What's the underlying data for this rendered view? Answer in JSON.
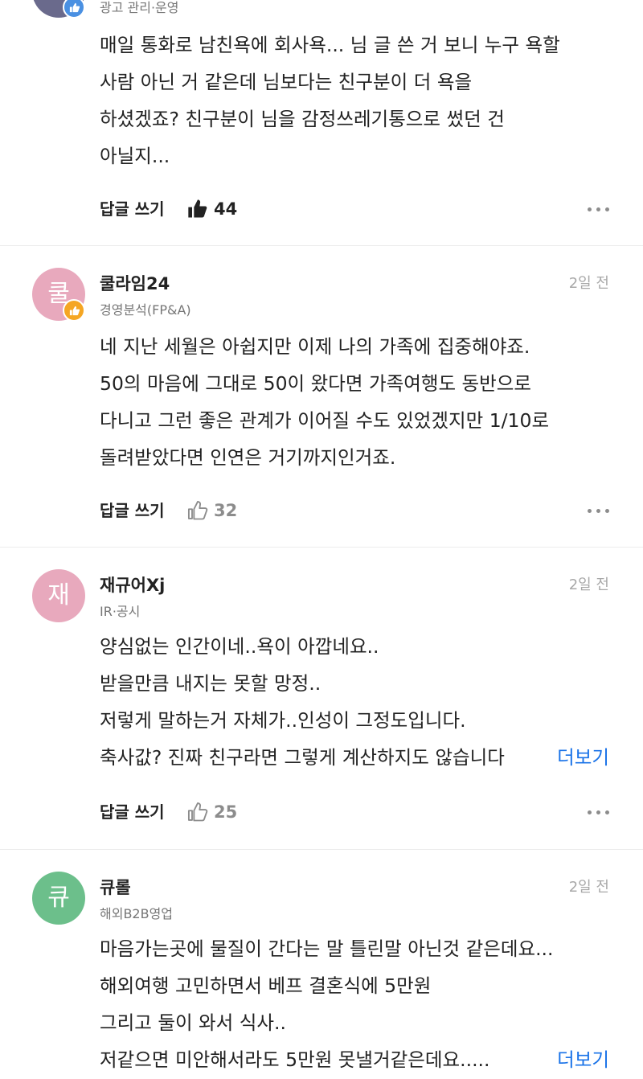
{
  "comments": [
    {
      "job": "광고 관리·운영",
      "lines": [
        "매일 통화로 남친욕에 회사욕... 님 글 쓴 거 보니 누구 욕할",
        "사람 아닌 거 같은데 님보다는 친구분이 더 욕을",
        "하셨겠죠? 친구분이 님을 감정쓰레기통으로 썼던 건",
        "아닐지..."
      ],
      "reply_label": "답글 쓰기",
      "likes": "44",
      "liked": true
    },
    {
      "avatar_char": "쿨",
      "avatar_color": "#e8a9bd",
      "username": "쿨라임24",
      "job": "경영분석(FP&A)",
      "time": "2일 전",
      "lines": [
        "네 지난 세월은 아쉽지만 이제 나의 가족에 집중해야죠.",
        "50의 마음에 그대로 50이 왔다면 가족여행도 동반으로",
        "다니고 그런 좋은 관계가 이어질 수도 있었겠지만 1/10로",
        "돌려받았다면 인연은 거기까지인거죠."
      ],
      "reply_label": "답글 쓰기",
      "likes": "32",
      "liked": false
    },
    {
      "avatar_char": "재",
      "avatar_color": "#e8a9bd",
      "username": "재규어Xj",
      "job": "IR·공시",
      "time": "2일 전",
      "lines": [
        "양심없는 인간이네..욕이 아깝네요..",
        "받을만큼 내지는 못할 망정..",
        "저렇게 말하는거 자체가..인성이 그정도입니다.",
        "축사값? 진짜 친구라면 그렇게 계산하지도 않습니다"
      ],
      "more_label": "더보기",
      "reply_label": "답글 쓰기",
      "likes": "25",
      "liked": false
    },
    {
      "avatar_char": "큐",
      "avatar_color": "#6cbf8b",
      "username": "큐롤",
      "job": "해외B2B영업",
      "time": "2일 전",
      "lines": [
        "마음가는곳에 물질이 간다는 말 틀린말 아닌것 같은데요...",
        "해외여행 고민하면서 베프 결혼식에 5만원",
        "그리고 둘이 와서 식사..",
        "저같으면 미안해서라도 5만원 못낼거같은데요....."
      ],
      "more_label": "더보기"
    }
  ],
  "icons": {
    "avatar_badge": "thumbs-up-badge-icon",
    "like_filled": "thumbs-up-filled-icon",
    "like_outline": "thumbs-up-outline-icon",
    "more": "more-dots-icon"
  },
  "colors": {
    "link": "#1a73e8",
    "badge": "#f5a623",
    "muted": "#767676"
  }
}
